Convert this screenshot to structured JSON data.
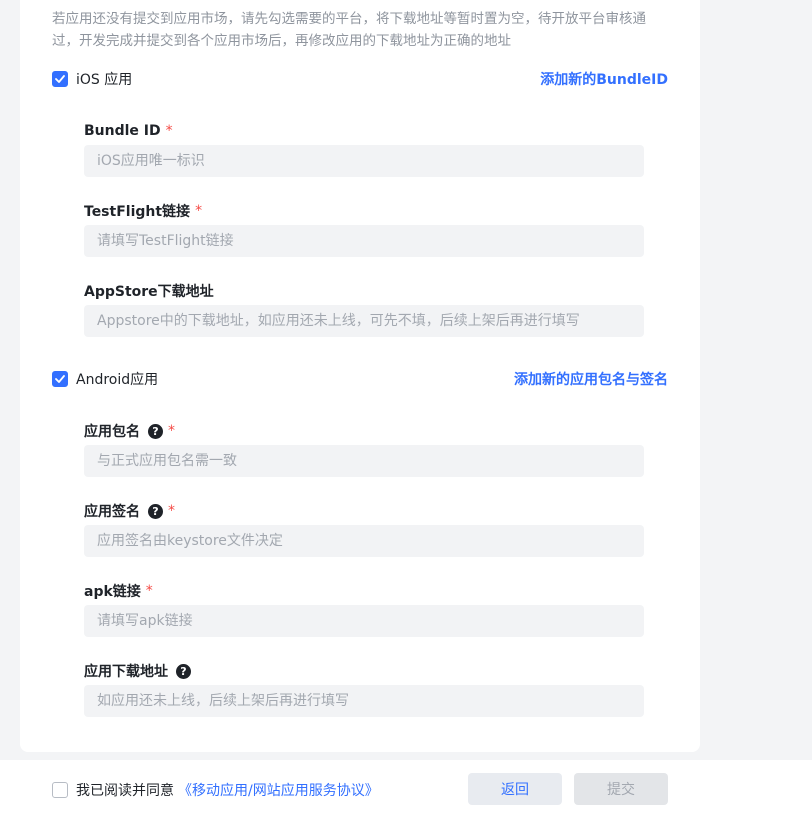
{
  "hint": "若应用还没有提交到应用市场，请先勾选需要的平台，将下载地址等暂时置为空，待开放平台审核通过，开发完成并提交到各个应用市场后，再修改应用的下载地址为正确的地址",
  "ios": {
    "label": "iOS 应用",
    "checked": true,
    "add_link": "添加新的BundleID",
    "fields": [
      {
        "label": "Bundle ID",
        "required": "*",
        "placeholder": "iOS应用唯一标识"
      },
      {
        "label": "TestFlight链接",
        "required": "*",
        "placeholder": "请填写TestFlight链接"
      },
      {
        "label": "AppStore下载地址",
        "required": "",
        "placeholder": "Appstore中的下载地址，如应用还未上线，可先不填，后续上架后再进行填写"
      }
    ]
  },
  "android": {
    "label": "Android应用",
    "checked": true,
    "add_link": "添加新的应用包名与签名",
    "fields": [
      {
        "label": "应用包名",
        "required": "*",
        "help": "?",
        "placeholder": "与正式应用包名需一致"
      },
      {
        "label": "应用签名",
        "required": "*",
        "help": "?",
        "placeholder": "应用签名由keystore文件决定"
      },
      {
        "label": "apk链接",
        "required": "*",
        "placeholder": "请填写apk链接"
      },
      {
        "label": "应用下载地址",
        "required": "",
        "help": "?",
        "placeholder": "如应用还未上线，后续上架后再进行填写"
      }
    ]
  },
  "footer": {
    "agree_text": "我已阅读并同意",
    "agree_link": "《移动应用/网站应用服务协议》",
    "back_label": "返回",
    "submit_label": "提交"
  },
  "colors": {
    "accent": "#3370ff",
    "required": "#f54a45"
  }
}
